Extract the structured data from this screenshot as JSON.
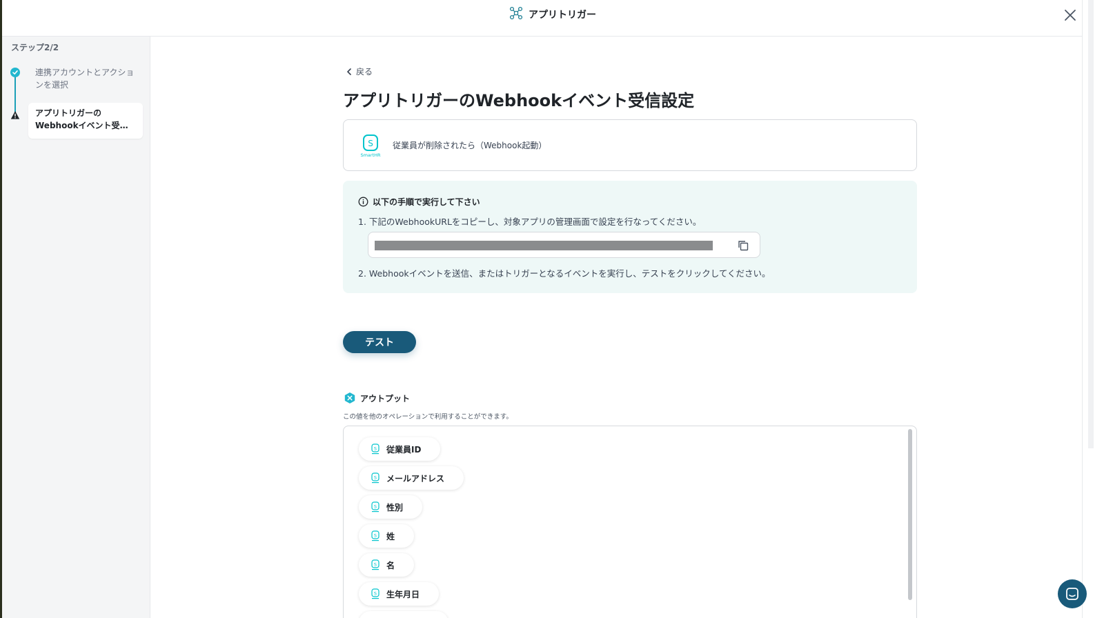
{
  "header": {
    "title": "アプリトリガー",
    "close_icon": "close-icon"
  },
  "sidebar": {
    "step_count": "ステップ2/2",
    "steps": [
      {
        "label": "連携アカウントとアクションを選択",
        "status": "completed",
        "icon": "check-circle-icon"
      },
      {
        "label": "アプリトリガーのWebhookイベント受信設定",
        "status": "warning",
        "icon": "warning-icon"
      }
    ]
  },
  "main": {
    "back_label": "戻る",
    "page_title": "アプリトリガーのWebhookイベント受信設定",
    "trigger": {
      "app_name": "SmartHR",
      "text": "従業員が削除されたら（Webhook起動）"
    },
    "instructions": {
      "heading": "以下の手順で実行して下さい",
      "step1": "1. 下記のWebhookURLをコピーし、対象アプリの管理画面で設定を行なってください。",
      "step2": "2. Webhookイベントを送信、またはトリガーとなるイベントを実行し、テストをクリックしてください。"
    },
    "test_button": "テスト",
    "output": {
      "heading": "アウトプット",
      "description": "この値を他のオペレーションで利用することができます。",
      "items": [
        "従業員ID",
        "メールアドレス",
        "性別",
        "姓",
        "名",
        "生年月日"
      ]
    }
  },
  "colors": {
    "accent": "#195a7a",
    "step_teal": "#22b7cf",
    "info_bg": "#eef8f7",
    "smarthr_teal": "#00c4cc"
  }
}
